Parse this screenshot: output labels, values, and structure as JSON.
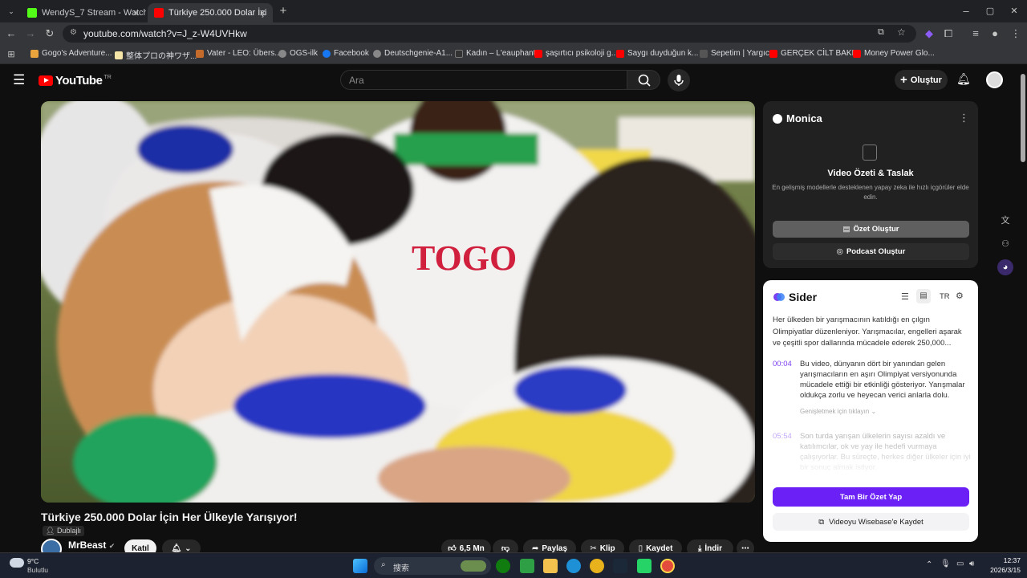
{
  "browser": {
    "tabs": [
      {
        "label": "WendyS_7 Stream - Watch Li",
        "active": false
      },
      {
        "label": "Türkiye 250.000 Dolar İçi",
        "active": true
      }
    ],
    "url": "youtube.com/watch?v=J_z-W4UVHkw",
    "bookmarks": [
      "Gogo's Adventure...",
      "整体プロの神ワザ...",
      "Vater - LEO: Übers...",
      "OGS-ilk",
      "Facebook",
      "Deutschgenie-A1...",
      "Kadın – L'eauphant",
      "şaşırtıcı psikoloji g...",
      "Saygı duyduğun k...",
      "Sepetim | Yargıcı",
      "GERÇEK CİLT BAKI...",
      "Money Power Glo..."
    ]
  },
  "youtube": {
    "logo": "YouTube",
    "logo_region": "TR",
    "search_placeholder": "Ara",
    "create_label": "Oluştur",
    "video_overlay_text": "TOGO",
    "video_title": "Türkiye 250.000 Dolar İçin Her Ülkeyle Yarışıyor!",
    "dub_badge": "Dublajlı",
    "channel": "MrBeast",
    "join_label": "Katıl",
    "actions": {
      "likes": "6,5 Mn",
      "share": "Paylaş",
      "clip": "Klip",
      "save": "Kaydet",
      "download": "İndir"
    }
  },
  "monica": {
    "name": "Monica",
    "heading": "Video Özeti & Taslak",
    "description": "En gelişmiş modellerle desteklenen yapay zeka ile hızlı içgörüler elde edin.",
    "summary_btn": "Özet Oluştur",
    "podcast_btn": "Podcast Oluştur"
  },
  "sider": {
    "name": "Sider",
    "lang": "TR",
    "intro": "Her ülkeden bir yarışmacının katıldığı en çılgın Olimpiyatlar düzenleniyor. Yarışmacılar, engelleri aşarak ve çeşitli spor dallarında mücadele ederek 250,000...",
    "items": [
      {
        "time": "00:04",
        "text": "Bu video, dünyanın dört bir yanından gelen yarışmacıların en aşırı Olimpiyat versiyonunda mücadele ettiği bir etkinliği gösteriyor. Yarışmalar oldukça zorlu ve heyecan verici anlarla dolu.",
        "expand": "Genişletmek için tıklayın ⌄"
      },
      {
        "time": "05:54",
        "text": "Son turda yarışan ülkelerin sayısı azaldı ve katılımcılar, ok ve yay ile hedefi vurmaya çalışıyorlar. Bu süreçte, herkes diğer ülkeler için iyi bir sonuç almak istiyor.",
        "expand": ""
      }
    ],
    "full_summary_btn": "Tam Bir Özet Yap",
    "save_btn": "Videoyu Wisebase'e Kaydet"
  },
  "taskbar": {
    "weather_temp": "9°C",
    "weather_desc": "Bulutlu",
    "search_label": "搜索",
    "time": "12:37",
    "date": "2026/3/15"
  },
  "colors": {
    "youtube_red": "#ff0000",
    "sider_purple": "#6b21f5",
    "monica_panel": "#212121"
  }
}
